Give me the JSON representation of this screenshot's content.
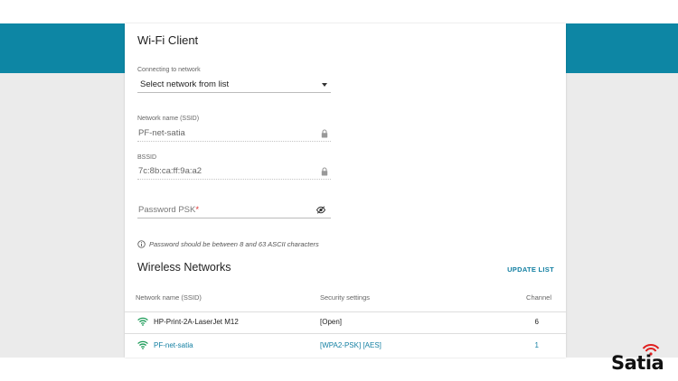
{
  "panel": {
    "title": "Wi-Fi Client",
    "connecting_label": "Connecting to network",
    "connecting_value": "Select network from list",
    "ssid_label": "Network name (SSID)",
    "ssid_value": "PF-net-satia",
    "bssid_label": "BSSID",
    "bssid_value": "7c:8b:ca:ff:9a:a2",
    "password_placeholder": "Password PSK",
    "password_required_mark": "*",
    "hint": "Password should be between 8 and 63 ASCII characters"
  },
  "networks": {
    "title": "Wireless Networks",
    "update_label": "UPDATE LIST",
    "columns": {
      "ssid": "Network name (SSID)",
      "security": "Security settings",
      "channel": "Channel"
    },
    "rows": [
      {
        "ssid": "HP-Print-2A-LaserJet M12",
        "security": "[Open]",
        "channel": "6",
        "selected": false
      },
      {
        "ssid": "PF-net-satia",
        "security": "[WPA2-PSK] [AES]",
        "channel": "1",
        "selected": true
      }
    ]
  },
  "brand": {
    "logo_text": "Satia"
  },
  "colors": {
    "header_band": "#0d86a4",
    "accent": "#127fa2",
    "logo_waves": "#e02020"
  },
  "icons": {
    "ssid_field": "lock-icon",
    "bssid_field": "lock-icon",
    "password_field": "eye-off-icon",
    "hint": "info-icon",
    "network_row": "wifi-icon"
  }
}
